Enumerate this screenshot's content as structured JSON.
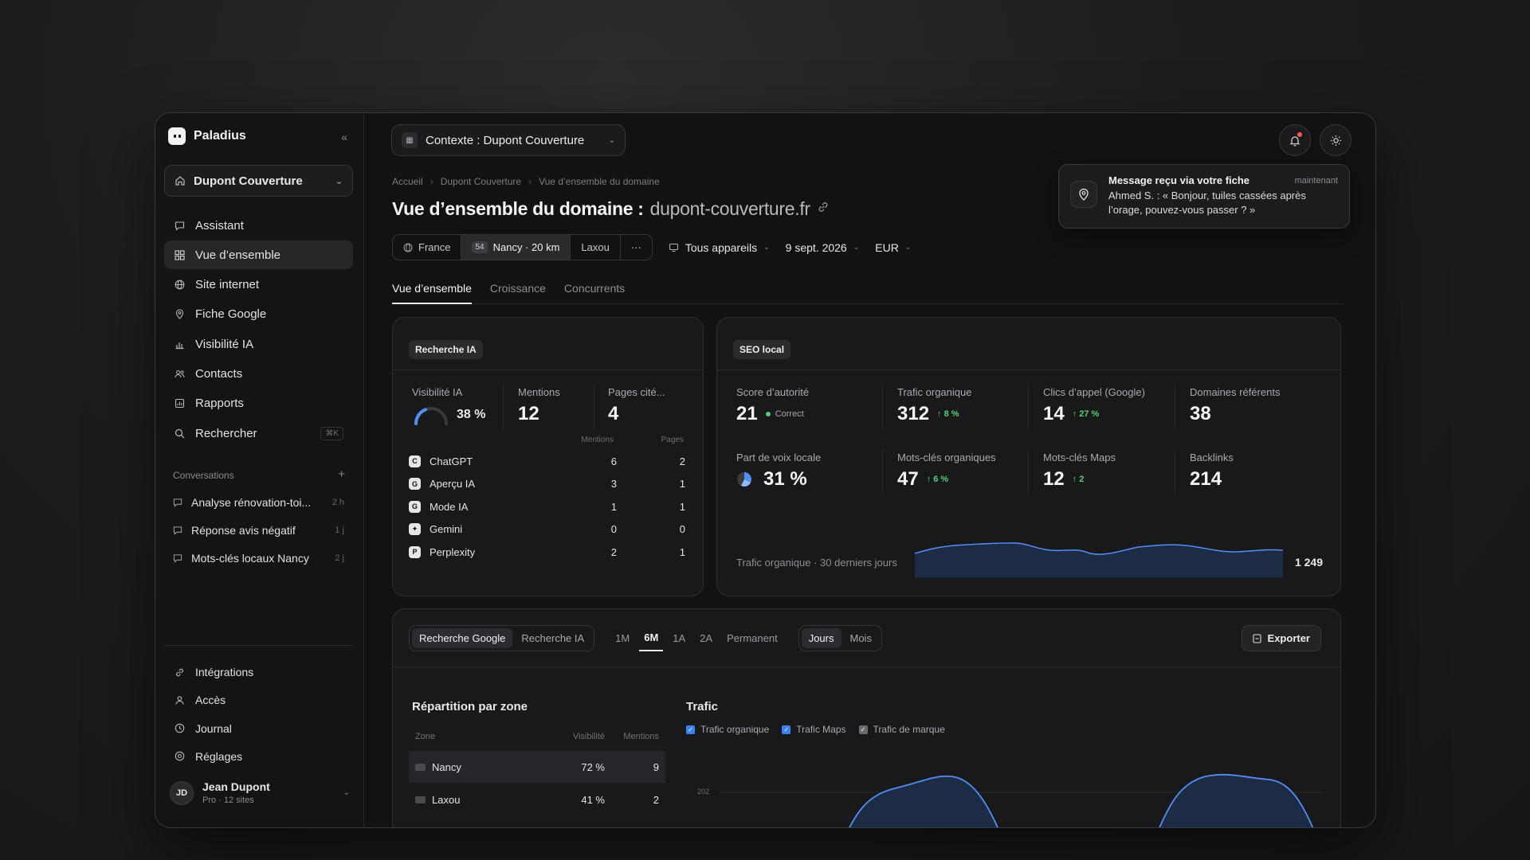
{
  "app": {
    "name": "Paladius"
  },
  "sidebar": {
    "site": "Dupont Couverture",
    "nav": [
      {
        "label": "Assistant",
        "icon": "chat-icon"
      },
      {
        "label": "Vue d’ensemble",
        "icon": "grid-icon",
        "active": true
      },
      {
        "label": "Site internet",
        "icon": "globe-icon"
      },
      {
        "label": "Fiche Google",
        "icon": "map-pin-icon"
      },
      {
        "label": "Visibilité IA",
        "icon": "bar-chart-icon"
      },
      {
        "label": "Contacts",
        "icon": "users-icon"
      },
      {
        "label": "Rapports",
        "icon": "report-icon"
      },
      {
        "label": "Rechercher",
        "icon": "search-icon",
        "shortcut": "⌘K"
      }
    ],
    "conversations_label": "Conversations",
    "conversations": [
      {
        "title": "Analyse rénovation-toi...",
        "age": "2 h"
      },
      {
        "title": "Réponse avis négatif",
        "age": "1 j"
      },
      {
        "title": "Mots-clés locaux Nancy",
        "age": "2 j"
      }
    ],
    "bottom_nav": [
      {
        "label": "Intégrations",
        "icon": "link-icon"
      },
      {
        "label": "Accès",
        "icon": "user-icon"
      },
      {
        "label": "Journal",
        "icon": "clock-icon"
      },
      {
        "label": "Réglages",
        "icon": "settings-icon"
      }
    ],
    "user": {
      "initials": "JD",
      "name": "Jean Dupont",
      "plan": "Pro · 12 sites"
    }
  },
  "header": {
    "context": "Contexte : Dupont Couverture",
    "breadcrumbs": [
      "Accueil",
      "Dupont Couverture",
      "Vue d’ensemble du domaine"
    ],
    "title": "Vue d’ensemble du domaine :",
    "domain": "dupont-couverture.fr"
  },
  "toast": {
    "title": "Message reçu via votre fiche",
    "time": "maintenant",
    "message": "Ahmed S. : « Bonjour, tuiles cassées après l’orage, pouvez-vous passer ? »"
  },
  "filters": {
    "country": "France",
    "zone_badge": "54",
    "zone": "Nancy · 20 km",
    "zone2": "Laxou",
    "more": "···",
    "devices": "Tous appareils",
    "date": "9 sept. 2026",
    "currency": "EUR"
  },
  "tabs": [
    "Vue d’ensemble",
    "Croissance",
    "Concurrents"
  ],
  "ai_card": {
    "pill": "Recherche IA",
    "visibility_label": "Visibilité IA",
    "visibility_value": "38 %",
    "visibility_fraction": 0.38,
    "mentions_label": "Mentions",
    "mentions_value": "12",
    "pages_label": "Pages cité...",
    "pages_value": "4",
    "col_mentions": "Mentions",
    "col_pages": "Pages",
    "engines": [
      {
        "name": "ChatGPT",
        "glyph": "C",
        "mentions": "6",
        "pages": "2"
      },
      {
        "name": "Aperçu IA",
        "glyph": "G",
        "mentions": "3",
        "pages": "1"
      },
      {
        "name": "Mode IA",
        "glyph": "G",
        "mentions": "1",
        "pages": "1"
      },
      {
        "name": "Gemini",
        "glyph": "✦",
        "mentions": "0",
        "pages": "0"
      },
      {
        "name": "Perplexity",
        "glyph": "P",
        "mentions": "2",
        "pages": "1"
      }
    ]
  },
  "seo_card": {
    "pill": "SEO local",
    "metrics": [
      {
        "label": "Score d’autorité",
        "value": "21",
        "note": "Correct"
      },
      {
        "label": "Trafic organique",
        "value": "312",
        "delta": "↑ 8 %"
      },
      {
        "label": "Clics d’appel (Google)",
        "value": "14",
        "delta": "↑ 27 %"
      },
      {
        "label": "Domaines référents",
        "value": "38"
      },
      {
        "label": "Part de voix locale",
        "value": "31 %"
      },
      {
        "label": "Mots-clés organiques",
        "value": "47",
        "delta": "↑ 6 %"
      },
      {
        "label": "Mots-clés Maps",
        "value": "12",
        "delta": "↑ 2"
      },
      {
        "label": "Backlinks",
        "value": "214"
      }
    ],
    "sparkline_label": "Trafic organique · 30 derniers jours",
    "sparkline_total": "1 249"
  },
  "bottom_card": {
    "source_tabs": [
      "Recherche Google",
      "Recherche IA"
    ],
    "ranges": [
      "1M",
      "6M",
      "1A",
      "2A",
      "Permanent"
    ],
    "granularity": [
      "Jours",
      "Mois"
    ],
    "export": "Exporter",
    "zone_title": "Répartition par zone",
    "zone_cols": [
      "Zone",
      "Visibilité",
      "Mentions"
    ],
    "zones": [
      {
        "name": "Nancy",
        "visibility": "72 %",
        "mentions": "9"
      },
      {
        "name": "Laxou",
        "visibility": "41 %",
        "mentions": "2"
      }
    ],
    "traffic_title": "Trafic",
    "legend": [
      {
        "label": "Trafic organique",
        "color": "#3b82f6"
      },
      {
        "label": "Trafic Maps",
        "color": "#3b82f6"
      },
      {
        "label": "Trafic de marque",
        "color": "#6b6b70"
      }
    ],
    "y_tick": "202"
  },
  "colors": {
    "accent": "#4f8ff7",
    "positive": "#4fd17a",
    "alert": "#ff5a4f"
  }
}
